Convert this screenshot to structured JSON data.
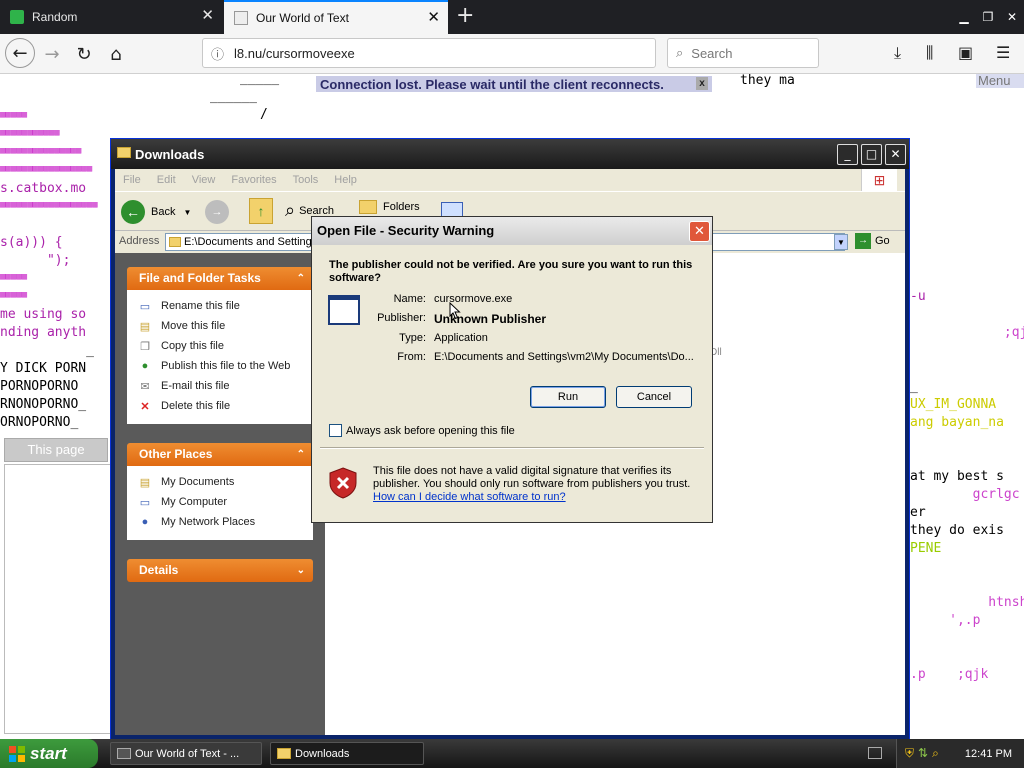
{
  "browser": {
    "tabs": [
      {
        "title": "Random",
        "active": false
      },
      {
        "title": "Our World of Text",
        "active": true
      }
    ],
    "url": "l8.nu/cursormoveexe",
    "search_placeholder": "Search"
  },
  "owot": {
    "banner": "Connection lost. Please wait until the client reconnects.",
    "banner_close": "x",
    "menu": "Menu",
    "top_text": "they ma",
    "top_underline": "_____",
    "top_underline2": "______",
    "top_slash": "/",
    "this_page": "This page",
    "left_lines": [
      {
        "text": "s.catbox.mo",
        "color": "#aa22aa"
      },
      {
        "text": "s(a))) {",
        "color": "#aa22aa"
      },
      {
        "text": "      \");",
        "color": "#aa22aa"
      },
      {
        "text": "me using so",
        "color": "#aa22aa"
      },
      {
        "text": "nding anyth",
        "color": "#aa22aa"
      },
      {
        "text": "           _",
        "color": "#000000"
      },
      {
        "text": "Y DICK PORN",
        "color": "#000000"
      },
      {
        "text": "PORNOPORNO",
        "color": "#000000"
      },
      {
        "text": "RNONOPORNO_",
        "color": "#000000"
      },
      {
        "text": "ORNOPORNO_",
        "color": "#000000"
      }
    ],
    "right_lines": [
      {
        "text": "-u",
        "color": "#aa22aa"
      },
      {
        "text": "            ;qjk",
        "color": "#cc44cc"
      },
      {
        "text": "_",
        "color": "#000000"
      },
      {
        "text": "UX_IM_GONNA",
        "color": "#cccc00"
      },
      {
        "text": "ang bayan_na",
        "color": "#cccc00"
      },
      {
        "text": "at my best s",
        "color": "#000000"
      },
      {
        "text": "        gcrlgc",
        "color": "#cc44cc"
      },
      {
        "text": "er",
        "color": "#000000"
      },
      {
        "text": "they do exis",
        "color": "#000000"
      },
      {
        "text": "PENE",
        "color": "#99cc00"
      },
      {
        "text": "          htnsh",
        "color": "#cc44cc"
      },
      {
        "text": "     ',.p",
        "color": "#cc44cc"
      },
      {
        "text": ".p    ;qjk",
        "color": "#cc44cc"
      }
    ]
  },
  "explorer": {
    "title": "Downloads",
    "menu": [
      "File",
      "Edit",
      "View",
      "Favorites",
      "Tools",
      "Help"
    ],
    "toolbar": {
      "back": "Back",
      "search": "Search",
      "folders": "Folders"
    },
    "address_label": "Address",
    "address_value": "E:\\Documents and Settings",
    "go": "Go",
    "file_tasks": {
      "title": "File and Folder Tasks",
      "items": [
        "Rename this file",
        "Move this file",
        "Copy this file",
        "Publish this file to the Web",
        "E-mail this file",
        "Delete this file"
      ]
    },
    "other_places": {
      "title": "Other Places",
      "items": [
        "My Documents",
        "My Computer",
        "My Network Places"
      ]
    },
    "details": {
      "title": "Details"
    },
    "partial_text": "Dll"
  },
  "dialog": {
    "title": "Open File - Security Warning",
    "question": "The publisher could not be verified.  Are you sure you want to run this software?",
    "fields": [
      {
        "label": "Name:",
        "value": "cursormove.exe",
        "bold": false
      },
      {
        "label": "Publisher:",
        "value": "Unknown Publisher",
        "bold": true
      },
      {
        "label": "Type:",
        "value": "Application",
        "bold": false
      },
      {
        "label": "From:",
        "value": "E:\\Documents and Settings\\vm2\\My Documents\\Do...",
        "bold": false
      }
    ],
    "run": "Run",
    "cancel": "Cancel",
    "checkbox": "Always ask before opening this file",
    "warning": "This file does not have a valid digital signature that verifies its publisher.  You should only run software from publishers you trust.",
    "link": "How can I decide what software to run?"
  },
  "taskbar": {
    "start": "start",
    "items": [
      {
        "label": "Our World of Text - ...",
        "active": false
      },
      {
        "label": "Downloads",
        "active": true
      }
    ],
    "clock": "12:41 PM"
  }
}
